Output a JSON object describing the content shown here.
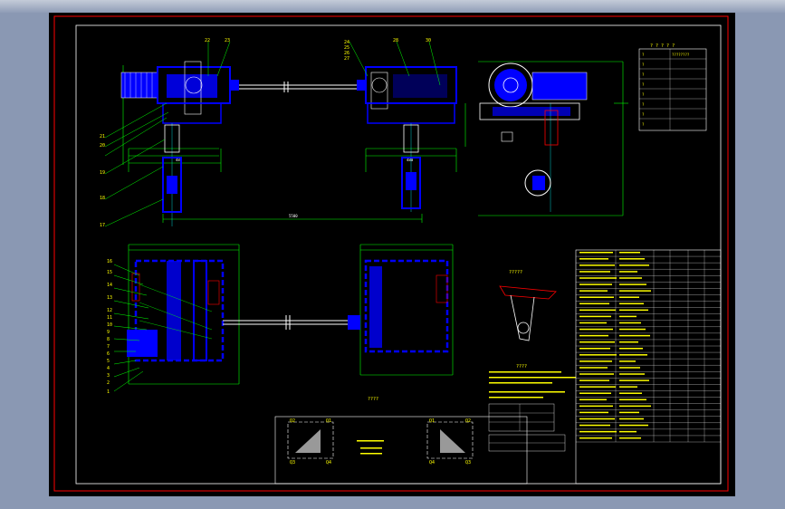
{
  "colors": {
    "background": "#000000",
    "border_outer": "#ff0000",
    "border_inner": "#ffffff",
    "part_blue": "#0000ff",
    "dimension_green": "#00ff00",
    "annotation_yellow": "#ffff00",
    "centerline_cyan": "#00ffff",
    "outline_white": "#ffffff"
  },
  "drawing": {
    "upper_callouts": [
      "22",
      "23",
      "24",
      "25",
      "26",
      "27",
      "28",
      "29",
      "30"
    ],
    "left_callouts_upper": [
      "21",
      "20",
      "19",
      "18",
      "17"
    ],
    "left_callouts_lower": [
      "16",
      "15",
      "14",
      "13",
      "12",
      "11",
      "10",
      "9",
      "8",
      "7",
      "6",
      "5",
      "4",
      "3",
      "2",
      "1"
    ],
    "title_center": "????",
    "detail_top_labels": [
      "Q2",
      "Q1",
      "Q1",
      "Q2"
    ],
    "detail_bottom_labels": [
      "Q3",
      "Q4",
      "Q4",
      "Q3"
    ],
    "spec_header": "? ? ? ? ?",
    "spec_rows": [
      [
        "?",
        "????????"
      ],
      [
        "?",
        "?"
      ],
      [
        "?",
        "?"
      ],
      [
        "?",
        "??"
      ],
      [
        "?",
        "?"
      ],
      [
        "?",
        "?"
      ],
      [
        "?",
        "?"
      ],
      [
        "?",
        "?"
      ]
    ],
    "tech_notes_title": "????",
    "table_rows": 30
  }
}
